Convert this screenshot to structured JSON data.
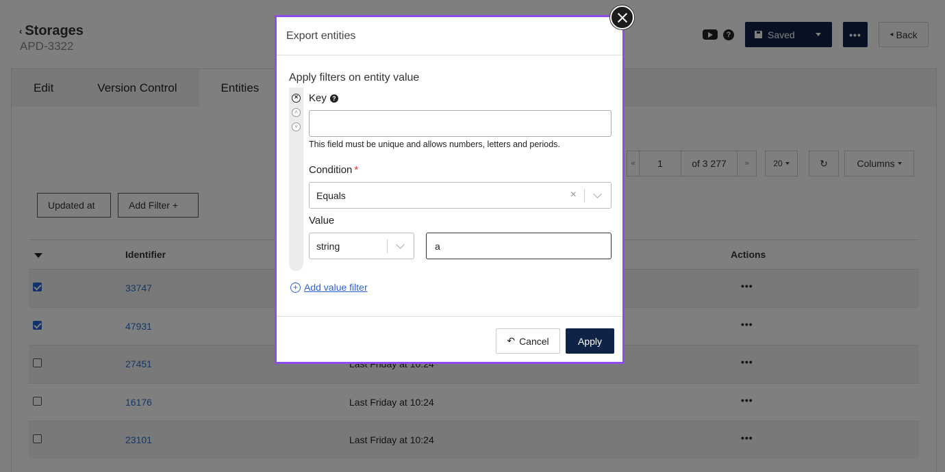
{
  "header": {
    "breadcrumb": "Storages",
    "subtitle": "APD-3322",
    "saved_label": "Saved",
    "more_label": "•••",
    "back_label": "Back"
  },
  "tabs": [
    {
      "label": "Edit"
    },
    {
      "label": "Version Control"
    },
    {
      "label": "Entities"
    }
  ],
  "pager": {
    "prev": "«",
    "page": "1",
    "of_label": "of 3 277",
    "next": "»",
    "page_size": "20",
    "refresh": "↻",
    "columns_label": "Columns"
  },
  "filters": {
    "updated_at": "Updated at",
    "add_filter": "Add Filter +"
  },
  "table": {
    "headers": {
      "identifier": "Identifier",
      "actions": "Actions"
    },
    "rows": [
      {
        "id": "33747",
        "date": "",
        "checked": true
      },
      {
        "id": "47931",
        "date": "",
        "checked": true
      },
      {
        "id": "27451",
        "date": "Last Friday at 10:24",
        "checked": false
      },
      {
        "id": "16176",
        "date": "Last Friday at 10:24",
        "checked": false
      },
      {
        "id": "23101",
        "date": "Last Friday at 10:24",
        "checked": false
      }
    ],
    "action_glyph": "•••"
  },
  "modal": {
    "title": "Export entities",
    "section_title": "Apply filters on entity value",
    "key_label": "Key",
    "key_value": "",
    "key_hint": "This field must be unique and allows numbers, letters and periods.",
    "condition_label": "Condition",
    "required_mark": "*",
    "condition_value": "Equals",
    "value_label": "Value",
    "value_type": "string",
    "value_input": "a",
    "add_value_filter": "Add value filter",
    "cancel_label": "Cancel",
    "apply_label": "Apply"
  },
  "colors": {
    "primary": "#0f2347",
    "link": "#2c6fc4",
    "modal_border": "#8f4bf0",
    "required": "#dd3333"
  }
}
